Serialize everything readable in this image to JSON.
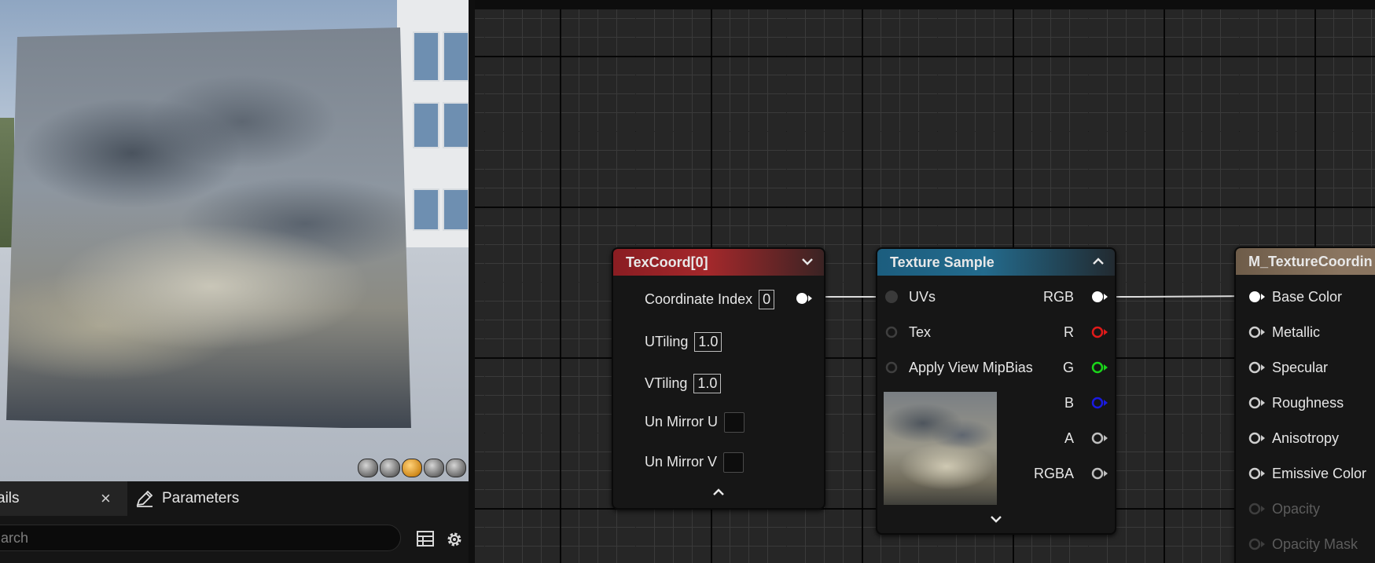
{
  "bottom_panel": {
    "details_tab_label": "ails",
    "close_symbol": "×",
    "parameters_tab_label": "Parameters",
    "search_placeholder": "arch"
  },
  "nodes": {
    "texcoord": {
      "title": "TexCoord[0]",
      "header_color": "#a4282b",
      "coordinate_index_label": "Coordinate Index",
      "coordinate_index_value": "0",
      "utiling_label": "UTiling",
      "utiling_value": "1.0",
      "vtiling_label": "VTiling",
      "vtiling_value": "1.0",
      "un_mirror_u_label": "Un Mirror U",
      "un_mirror_v_label": "Un Mirror V"
    },
    "texture_sample": {
      "title": "Texture Sample",
      "header_color": "#236b8d",
      "inputs": [
        "UVs",
        "Tex",
        "Apply View MipBias"
      ],
      "outputs": [
        {
          "label": "RGB",
          "color": "#ffffff"
        },
        {
          "label": "R",
          "color": "#e01a1a"
        },
        {
          "label": "G",
          "color": "#1ad61a"
        },
        {
          "label": "B",
          "color": "#1a1ae0"
        },
        {
          "label": "A",
          "color": "#bfbfbf"
        },
        {
          "label": "RGBA",
          "color": "#bfbfbf"
        }
      ]
    },
    "material": {
      "title": "M_TextureCoordin",
      "header_color": "#8a7560",
      "inputs": [
        {
          "label": "Base Color",
          "enabled": true
        },
        {
          "label": "Metallic",
          "enabled": true
        },
        {
          "label": "Specular",
          "enabled": true
        },
        {
          "label": "Roughness",
          "enabled": true
        },
        {
          "label": "Anisotropy",
          "enabled": true
        },
        {
          "label": "Emissive Color",
          "enabled": true
        },
        {
          "label": "Opacity",
          "enabled": false
        },
        {
          "label": "Opacity Mask",
          "enabled": false
        }
      ]
    }
  },
  "icons": [
    "close-icon",
    "pencil-icon",
    "table-icon",
    "gear-icon",
    "chevron-down-icon",
    "chevron-up-icon"
  ],
  "colors": {
    "graph_background": "#262626",
    "wire": "#dcdcdc",
    "active_view_button": "#d08a1c"
  }
}
